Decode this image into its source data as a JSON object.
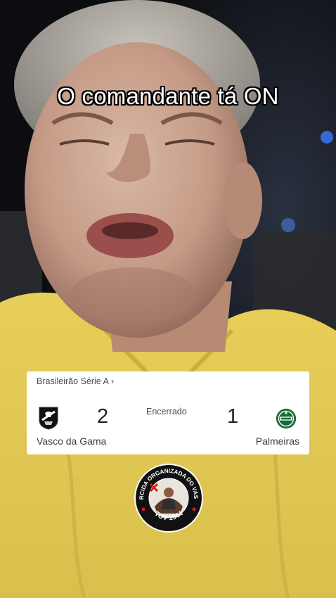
{
  "video": {
    "caption": "O comandante tá ON"
  },
  "score_card": {
    "competition": "Brasileirão Série A",
    "competition_chevron": "›",
    "status": "Encerrado",
    "home": {
      "name": "Vasco da Gama",
      "score": "2",
      "logo": "vasco-crest-icon"
    },
    "away": {
      "name": "Palmeiras",
      "score": "1",
      "logo": "palmeiras-crest-icon"
    }
  },
  "watermark": {
    "top_text": "TORCIDA ORGANIZADA DO VASCO",
    "bottom_text": "TOV 1944"
  },
  "colors": {
    "shirt_yellow": "#e9d25a",
    "vasco_black": "#111111",
    "palmeiras_green": "#1b6b3a",
    "badge_red": "#c8201f"
  }
}
